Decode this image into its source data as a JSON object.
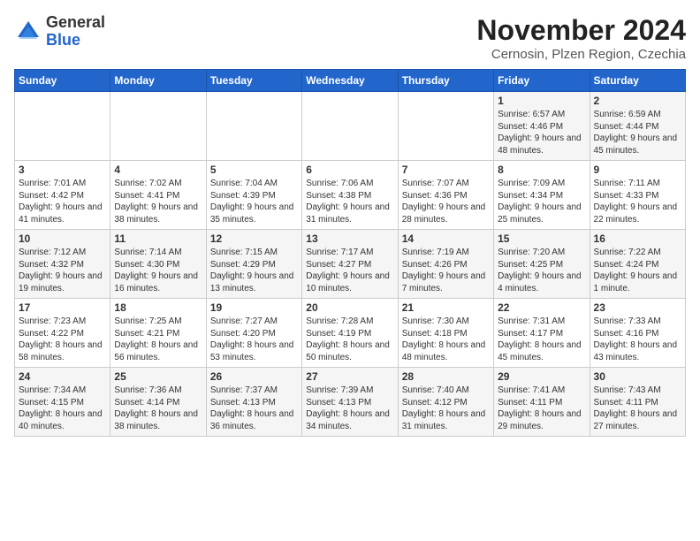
{
  "header": {
    "logo_general": "General",
    "logo_blue": "Blue",
    "month_title": "November 2024",
    "location": "Cernosin, Plzen Region, Czechia"
  },
  "weekdays": [
    "Sunday",
    "Monday",
    "Tuesday",
    "Wednesday",
    "Thursday",
    "Friday",
    "Saturday"
  ],
  "weeks": [
    [
      {
        "day": "",
        "info": ""
      },
      {
        "day": "",
        "info": ""
      },
      {
        "day": "",
        "info": ""
      },
      {
        "day": "",
        "info": ""
      },
      {
        "day": "",
        "info": ""
      },
      {
        "day": "1",
        "info": "Sunrise: 6:57 AM\nSunset: 4:46 PM\nDaylight: 9 hours and 48 minutes."
      },
      {
        "day": "2",
        "info": "Sunrise: 6:59 AM\nSunset: 4:44 PM\nDaylight: 9 hours and 45 minutes."
      }
    ],
    [
      {
        "day": "3",
        "info": "Sunrise: 7:01 AM\nSunset: 4:42 PM\nDaylight: 9 hours and 41 minutes."
      },
      {
        "day": "4",
        "info": "Sunrise: 7:02 AM\nSunset: 4:41 PM\nDaylight: 9 hours and 38 minutes."
      },
      {
        "day": "5",
        "info": "Sunrise: 7:04 AM\nSunset: 4:39 PM\nDaylight: 9 hours and 35 minutes."
      },
      {
        "day": "6",
        "info": "Sunrise: 7:06 AM\nSunset: 4:38 PM\nDaylight: 9 hours and 31 minutes."
      },
      {
        "day": "7",
        "info": "Sunrise: 7:07 AM\nSunset: 4:36 PM\nDaylight: 9 hours and 28 minutes."
      },
      {
        "day": "8",
        "info": "Sunrise: 7:09 AM\nSunset: 4:34 PM\nDaylight: 9 hours and 25 minutes."
      },
      {
        "day": "9",
        "info": "Sunrise: 7:11 AM\nSunset: 4:33 PM\nDaylight: 9 hours and 22 minutes."
      }
    ],
    [
      {
        "day": "10",
        "info": "Sunrise: 7:12 AM\nSunset: 4:32 PM\nDaylight: 9 hours and 19 minutes."
      },
      {
        "day": "11",
        "info": "Sunrise: 7:14 AM\nSunset: 4:30 PM\nDaylight: 9 hours and 16 minutes."
      },
      {
        "day": "12",
        "info": "Sunrise: 7:15 AM\nSunset: 4:29 PM\nDaylight: 9 hours and 13 minutes."
      },
      {
        "day": "13",
        "info": "Sunrise: 7:17 AM\nSunset: 4:27 PM\nDaylight: 9 hours and 10 minutes."
      },
      {
        "day": "14",
        "info": "Sunrise: 7:19 AM\nSunset: 4:26 PM\nDaylight: 9 hours and 7 minutes."
      },
      {
        "day": "15",
        "info": "Sunrise: 7:20 AM\nSunset: 4:25 PM\nDaylight: 9 hours and 4 minutes."
      },
      {
        "day": "16",
        "info": "Sunrise: 7:22 AM\nSunset: 4:24 PM\nDaylight: 9 hours and 1 minute."
      }
    ],
    [
      {
        "day": "17",
        "info": "Sunrise: 7:23 AM\nSunset: 4:22 PM\nDaylight: 8 hours and 58 minutes."
      },
      {
        "day": "18",
        "info": "Sunrise: 7:25 AM\nSunset: 4:21 PM\nDaylight: 8 hours and 56 minutes."
      },
      {
        "day": "19",
        "info": "Sunrise: 7:27 AM\nSunset: 4:20 PM\nDaylight: 8 hours and 53 minutes."
      },
      {
        "day": "20",
        "info": "Sunrise: 7:28 AM\nSunset: 4:19 PM\nDaylight: 8 hours and 50 minutes."
      },
      {
        "day": "21",
        "info": "Sunrise: 7:30 AM\nSunset: 4:18 PM\nDaylight: 8 hours and 48 minutes."
      },
      {
        "day": "22",
        "info": "Sunrise: 7:31 AM\nSunset: 4:17 PM\nDaylight: 8 hours and 45 minutes."
      },
      {
        "day": "23",
        "info": "Sunrise: 7:33 AM\nSunset: 4:16 PM\nDaylight: 8 hours and 43 minutes."
      }
    ],
    [
      {
        "day": "24",
        "info": "Sunrise: 7:34 AM\nSunset: 4:15 PM\nDaylight: 8 hours and 40 minutes."
      },
      {
        "day": "25",
        "info": "Sunrise: 7:36 AM\nSunset: 4:14 PM\nDaylight: 8 hours and 38 minutes."
      },
      {
        "day": "26",
        "info": "Sunrise: 7:37 AM\nSunset: 4:13 PM\nDaylight: 8 hours and 36 minutes."
      },
      {
        "day": "27",
        "info": "Sunrise: 7:39 AM\nSunset: 4:13 PM\nDaylight: 8 hours and 34 minutes."
      },
      {
        "day": "28",
        "info": "Sunrise: 7:40 AM\nSunset: 4:12 PM\nDaylight: 8 hours and 31 minutes."
      },
      {
        "day": "29",
        "info": "Sunrise: 7:41 AM\nSunset: 4:11 PM\nDaylight: 8 hours and 29 minutes."
      },
      {
        "day": "30",
        "info": "Sunrise: 7:43 AM\nSunset: 4:11 PM\nDaylight: 8 hours and 27 minutes."
      }
    ]
  ]
}
